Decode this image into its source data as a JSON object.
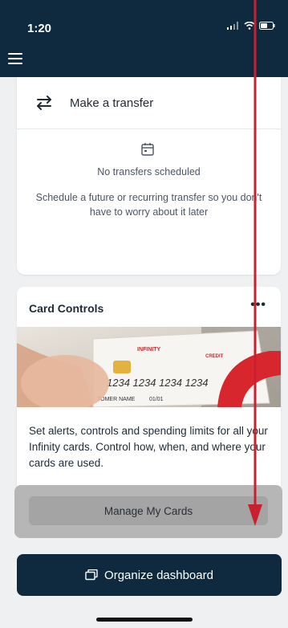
{
  "status_bar": {
    "time": "1:20"
  },
  "transfer_card": {
    "title": "Make a transfer",
    "empty_title": "No transfers scheduled",
    "empty_description": "Schedule a future or recurring transfer so you don't have to worry about it later"
  },
  "card_controls": {
    "title": "Card Controls",
    "more_label": "•••",
    "card_brand": "INFINITY",
    "card_type": "CREDIT",
    "card_number": "1234 1234 1234 1234",
    "card_holder": "TOMER NAME",
    "card_expiry": "01/01",
    "description": "Set alerts, controls and spending limits for all your Infinity cards. Control how, when, and where your cards are used.",
    "manage_button": "Manage My Cards"
  },
  "organize_button": "Organize dashboard",
  "colors": {
    "header_bg": "#0f2a3f",
    "annotation_arrow": "#c8202f",
    "overlay": "#b6b6b6"
  }
}
